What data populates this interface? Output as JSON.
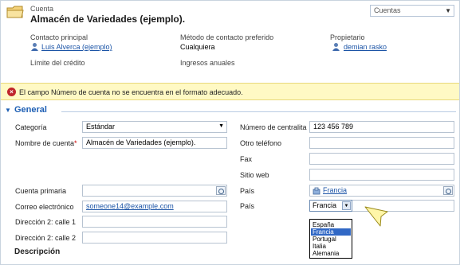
{
  "header": {
    "entity_type": "Cuenta",
    "record_title": "Almacén de Variedades (ejemplo).",
    "view_selector": "Cuentas"
  },
  "summary": {
    "primary_contact": {
      "label": "Contacto principal",
      "value": "Luis Alverca (ejemplo)"
    },
    "contact_method": {
      "label": "Método de contacto preferido",
      "value": "Cualquiera"
    },
    "owner": {
      "label": "Propietario",
      "value": "demian rasko"
    },
    "credit_limit": {
      "label": "Límite del crédito"
    },
    "annual_revenue": {
      "label": "Ingresos anuales"
    }
  },
  "notification": {
    "text": "El campo Número de cuenta no se encuentra en el formato adecuado."
  },
  "section": {
    "title": "General"
  },
  "form": {
    "category": {
      "label": "Categoría",
      "value": "Estándar"
    },
    "account_name": {
      "label": "Nombre de cuenta",
      "required_mark": "*",
      "value": "Almacén de Variedades (ejemplo)."
    },
    "main_phone": {
      "label": "Número de centralita",
      "value": "123 456 789"
    },
    "other_phone": {
      "label": "Otro teléfono",
      "value": ""
    },
    "fax": {
      "label": "Fax",
      "value": ""
    },
    "website": {
      "label": "Sitio web",
      "value": ""
    },
    "parent_account": {
      "label": "Cuenta primaria",
      "value": ""
    },
    "email": {
      "label": "Correo electrónico",
      "value": "someone14@example.com"
    },
    "country_lookup": {
      "label": "País",
      "value": "Francia"
    },
    "country_select": {
      "label": "País",
      "value": "Francia",
      "options": [
        "España",
        "Francia",
        "Portugal",
        "Italia",
        "Alemania"
      ],
      "selected": "Francia"
    },
    "address2_line1": {
      "label": "Dirección 2: calle 1",
      "value": ""
    },
    "address2_line2": {
      "label": "Dirección 2: calle 2",
      "value": ""
    }
  },
  "description_section": {
    "title": "Descripción"
  },
  "colors": {
    "link": "#1a53a6",
    "section": "#1e5fb4",
    "notification_bg": "#fff9c4",
    "error": "#c0262d",
    "callout": "#fff6a8"
  },
  "icons": {
    "entity": "account-folder-icon",
    "user": "user-icon",
    "error": "error-icon",
    "lookup": "lookup-icon",
    "callout": "callout-arrow-icon"
  }
}
